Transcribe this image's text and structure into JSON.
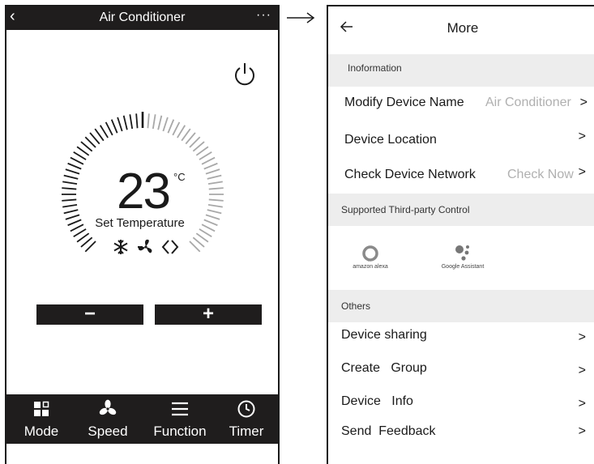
{
  "left_phone": {
    "title": "Air Conditioner",
    "back_icon": "chevron-left-icon",
    "more_icon": "ellipsis-icon",
    "power_icon": "power-icon",
    "temperature": "23",
    "unit": "°C",
    "set_label": "Set Temperature",
    "mode_icons": [
      "snowflake-icon",
      "fan-icon",
      "auto-cycle-icon"
    ],
    "minus_label": "−",
    "plus_label": "+",
    "tabs": [
      {
        "label": "Mode",
        "icon": "mode-grid-icon"
      },
      {
        "label": "Speed",
        "icon": "fan-icon"
      },
      {
        "label": "Function",
        "icon": "menu-icon"
      },
      {
        "label": "Timer",
        "icon": "clock-icon"
      }
    ]
  },
  "right_phone": {
    "title": "More",
    "back_icon": "arrow-left-icon",
    "section_information": "Inoformation",
    "rows_info": [
      {
        "label": "Modify Device Name",
        "value": "Air Conditioner"
      },
      {
        "label": "Device Location",
        "value": ""
      },
      {
        "label": "Check Device Network",
        "value": "Check Now"
      }
    ],
    "section_third_party": "Supported  Third-party  Control",
    "assistants": [
      {
        "label": "amazon alexa",
        "icon": "alexa-icon"
      },
      {
        "label": "Google Assistant",
        "icon": "google-assistant-icon"
      }
    ],
    "section_others": "Others",
    "rows_others": [
      {
        "label": "Device sharing"
      },
      {
        "label": "Create   Group"
      },
      {
        "label": "Device   Info"
      },
      {
        "label": "Send  Feedback"
      }
    ],
    "chevron": ">"
  },
  "colors": {
    "bar": "#1f1d1d",
    "section": "#ededed",
    "muted": "#b0b0b0"
  }
}
